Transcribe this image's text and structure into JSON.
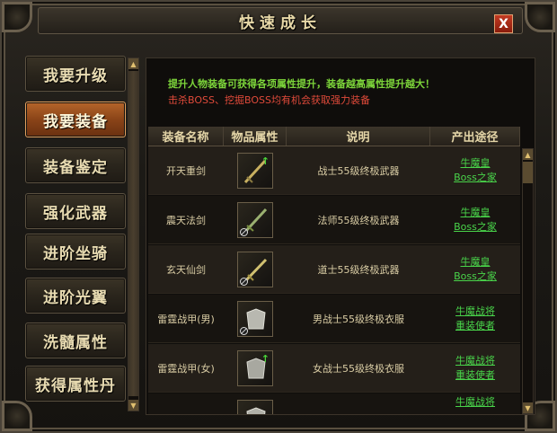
{
  "window": {
    "title": "快速成长",
    "close_label": "X"
  },
  "menu": {
    "items": [
      {
        "label": "我要升级",
        "active": false
      },
      {
        "label": "我要装备",
        "active": true
      },
      {
        "label": "装备鉴定",
        "active": false
      },
      {
        "label": "强化武器",
        "active": false
      },
      {
        "label": "进阶坐骑",
        "active": false
      },
      {
        "label": "进阶光翼",
        "active": false
      },
      {
        "label": "洗髓属性",
        "active": false
      },
      {
        "label": "获得属性丹",
        "active": false
      }
    ]
  },
  "notice": {
    "line1": "提升人物装备可获得各项属性提升，装备越高属性提升越大！",
    "line2": "击杀BOSS、挖掘BOSS均有机会获取强力装备"
  },
  "table": {
    "headers": [
      "装备名称",
      "物品属性",
      "说明",
      "产出途径"
    ],
    "rows": [
      {
        "name": "开天重剑",
        "desc": "战士55级终极武器",
        "source1": "牛魔皇",
        "source2": "Boss之家",
        "icon": "sword-icon",
        "upgrade": true,
        "forbid": false
      },
      {
        "name": "震天法剑",
        "desc": "法师55级终极武器",
        "source1": "牛魔皇",
        "source2": "Boss之家",
        "icon": "sword-icon",
        "upgrade": false,
        "forbid": true
      },
      {
        "name": "玄天仙剑",
        "desc": "道士55级终极武器",
        "source1": "牛魔皇",
        "source2": "Boss之家",
        "icon": "sword-icon",
        "upgrade": false,
        "forbid": true
      },
      {
        "name": "雷霆战甲(男)",
        "desc": "男战士55级终极衣服",
        "source1": "牛魔战将",
        "source2": "重装使者",
        "icon": "armor-icon",
        "upgrade": false,
        "forbid": true
      },
      {
        "name": "雷霆战甲(女)",
        "desc": "女战士55级终极衣服",
        "source1": "牛魔战将",
        "source2": "重装使者",
        "icon": "armor-icon",
        "upgrade": true,
        "forbid": false
      },
      {
        "name": "",
        "desc": "",
        "source1": "牛魔战将",
        "source2": "",
        "icon": "armor-icon",
        "upgrade": false,
        "forbid": false
      }
    ]
  },
  "colors": {
    "accent": "#b5652a",
    "link": "#49d44a",
    "notice_green": "#7cd43a",
    "notice_red": "#e04a3a"
  }
}
